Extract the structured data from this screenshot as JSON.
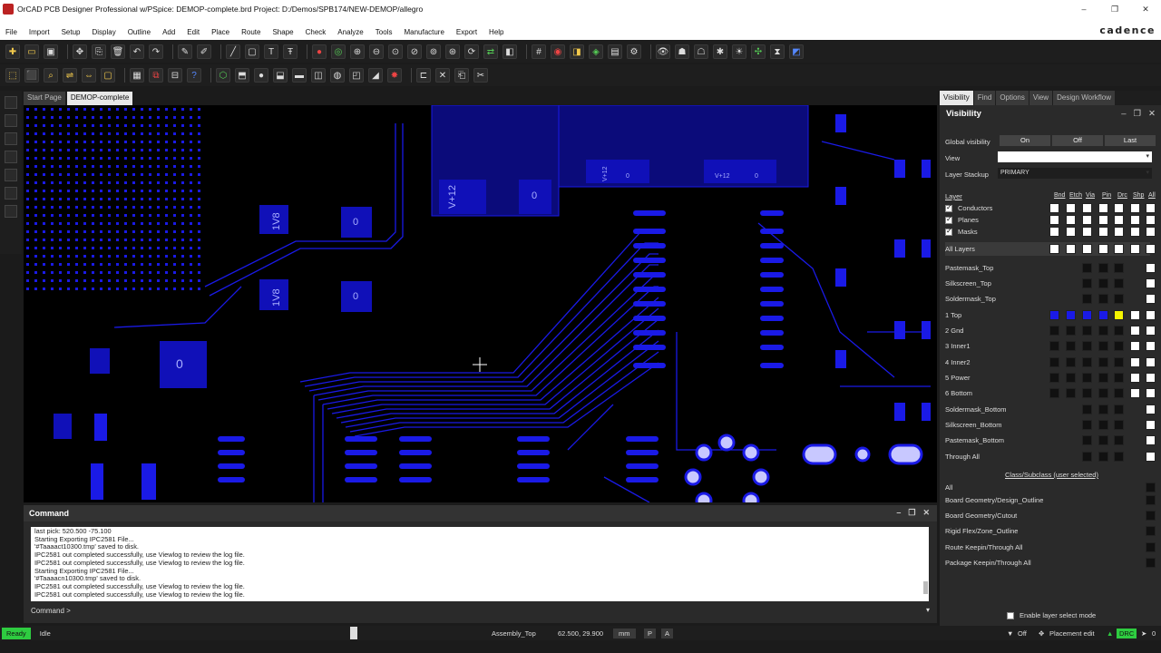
{
  "title": "OrCAD PCB Designer Professional w/PSpice: DEMOP-complete.brd  Project: D:/Demos/SPB174/NEW-DEMOP/allegro",
  "brand": "cadence",
  "window_controls": [
    "–",
    "❐",
    "✕"
  ],
  "menu": [
    "File",
    "Import",
    "Setup",
    "Display",
    "Outline",
    "Add",
    "Edit",
    "Place",
    "Route",
    "Shape",
    "Check",
    "Analyze",
    "Tools",
    "Manufacture",
    "Export",
    "Help"
  ],
  "tabs": [
    "Start Page",
    "DEMOP-complete"
  ],
  "canvas_labels": {
    "v12_a": "V+12",
    "zero_a": "0",
    "v18_a": "1V8",
    "zero_b": "0",
    "v18_b": "1V8",
    "zero_c": "0",
    "zero_d": "0",
    "v12_b": "V+12",
    "zero_e": "0",
    "zero_f": "0",
    "v12_c": "V+12"
  },
  "command": {
    "title": "Command",
    "log": [
      "last pick:  520.500 -75.100",
      "Starting Exporting IPC2581 File...",
      "'#Taaaact10300.tmp' saved to disk.",
      "IPC2581 out completed successfully, use Viewlog to review the log file.",
      "IPC2581 out completed successfully, use Viewlog to review the log file.",
      "Starting Exporting IPC2581 File...",
      "'#Taaaacn10300.tmp' saved to disk.",
      "IPC2581 out completed successfully, use Viewlog to review the log file.",
      "IPC2581 out completed successfully, use Viewlog to review the log file."
    ],
    "prompt": "Command >"
  },
  "status": {
    "ready": "Ready",
    "idle": "Idle",
    "layer": "Assembly_Top",
    "coords": "62.500, 29.900",
    "units": "mm",
    "p": "P",
    "a": "A",
    "filter": "Off",
    "mode": "Placement edit",
    "drc": "DRC",
    "count": "0"
  },
  "panel": {
    "tabs": [
      "Visibility",
      "Find",
      "Options",
      "View",
      "Design Workflow"
    ],
    "title": "Visibility",
    "global_label": "Global visibility",
    "global_btns": [
      "On",
      "Off",
      "Last"
    ],
    "view_label": "View",
    "view_value": "",
    "stackup_label": "Layer Stackup",
    "stackup_value": "PRIMARY",
    "col_header": "Layer",
    "cols": [
      "Bnd",
      "Etch",
      "Via",
      "Pin",
      "Drc",
      "Shp",
      "All"
    ],
    "groups": [
      "Conductors",
      "Planes",
      "Masks"
    ],
    "all_layers": "All Layers",
    "layers": [
      "Pastemask_Top",
      "Silkscreen_Top",
      "Soldermask_Top",
      "1 Top",
      "2 Gnd",
      "3 Inner1",
      "4 Inner2",
      "5 Power",
      "6 Bottom",
      "Soldermask_Bottom",
      "Silkscreen_Bottom",
      "Pastemask_Bottom",
      "Through All"
    ],
    "class_header": "Class/Subclass (user selected)",
    "classes": [
      "All",
      "Board Geometry/Design_Outline",
      "Board Geometry/Cutout",
      "Rigid Flex/Zone_Outline",
      "Route Keepin/Through All",
      "Package Keepin/Through All"
    ],
    "enable_select": "Enable layer select mode"
  },
  "colors": {
    "copper": "#1a1ae6",
    "highlight": "#f5f500",
    "ready": "#2ecc40"
  }
}
